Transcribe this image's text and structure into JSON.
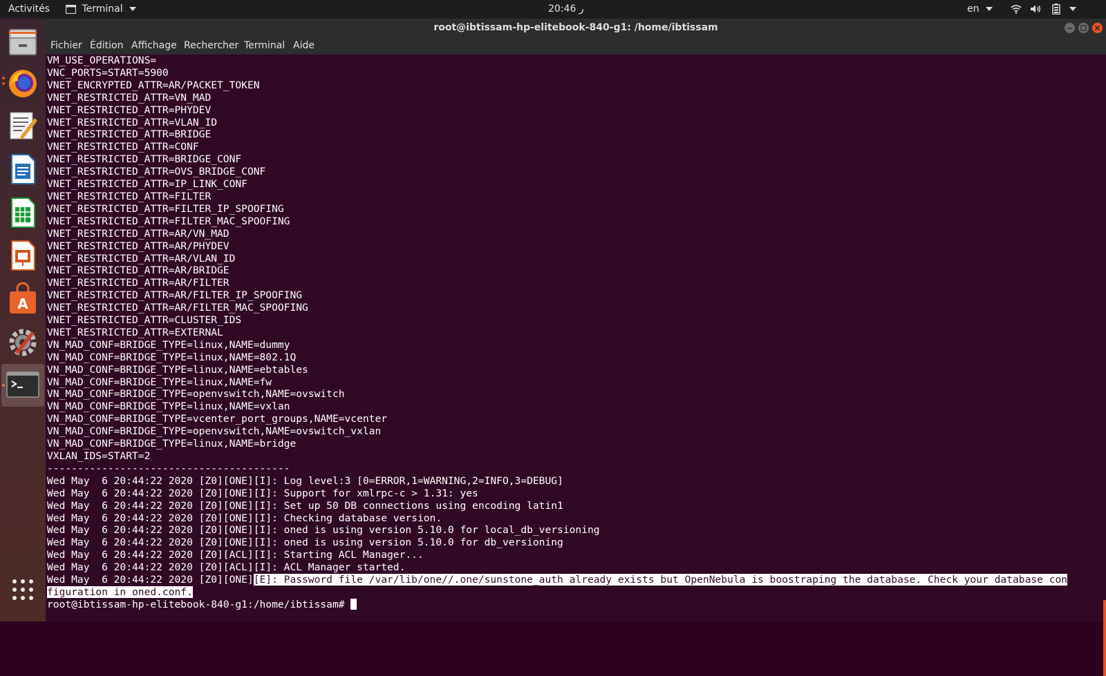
{
  "topbar": {
    "activities": "Activités",
    "app_menu": "Terminal",
    "clock": "20:46 ر",
    "lang": "en",
    "icons": [
      "wifi-icon",
      "volume-icon",
      "battery-icon",
      "system-menu-caret"
    ]
  },
  "window": {
    "title": "root@ibtissam-hp-elitebook-840-g1: /home/ibtissam",
    "menu": [
      "Fichier",
      "Édition",
      "Affichage",
      "Rechercher",
      "Terminal",
      "Aide"
    ]
  },
  "dock": {
    "apps": [
      "files-icon",
      "firefox-icon",
      "text-editor-icon",
      "writer-icon",
      "calc-icon",
      "impress-icon",
      "software-center-icon",
      "settings-icon",
      "terminal-icon",
      "show-apps-icon"
    ]
  },
  "colors": {
    "terminal_bg": "#300a24",
    "accent": "#e95420"
  },
  "terminal": {
    "lines": [
      "VM_USE_OPERATIONS=",
      "VNC_PORTS=START=5900",
      "VNET_ENCRYPTED_ATTR=AR/PACKET_TOKEN",
      "VNET_RESTRICTED_ATTR=VN_MAD",
      "VNET_RESTRICTED_ATTR=PHYDEV",
      "VNET_RESTRICTED_ATTR=VLAN_ID",
      "VNET_RESTRICTED_ATTR=BRIDGE",
      "VNET_RESTRICTED_ATTR=CONF",
      "VNET_RESTRICTED_ATTR=BRIDGE_CONF",
      "VNET_RESTRICTED_ATTR=OVS_BRIDGE_CONF",
      "VNET_RESTRICTED_ATTR=IP_LINK_CONF",
      "VNET_RESTRICTED_ATTR=FILTER",
      "VNET_RESTRICTED_ATTR=FILTER_IP_SPOOFING",
      "VNET_RESTRICTED_ATTR=FILTER_MAC_SPOOFING",
      "VNET_RESTRICTED_ATTR=AR/VN_MAD",
      "VNET_RESTRICTED_ATTR=AR/PHYDEV",
      "VNET_RESTRICTED_ATTR=AR/VLAN_ID",
      "VNET_RESTRICTED_ATTR=AR/BRIDGE",
      "VNET_RESTRICTED_ATTR=AR/FILTER",
      "VNET_RESTRICTED_ATTR=AR/FILTER_IP_SPOOFING",
      "VNET_RESTRICTED_ATTR=AR/FILTER_MAC_SPOOFING",
      "VNET_RESTRICTED_ATTR=CLUSTER_IDS",
      "VNET_RESTRICTED_ATTR=EXTERNAL",
      "VN_MAD_CONF=BRIDGE_TYPE=linux,NAME=dummy",
      "VN_MAD_CONF=BRIDGE_TYPE=linux,NAME=802.1Q",
      "VN_MAD_CONF=BRIDGE_TYPE=linux,NAME=ebtables",
      "VN_MAD_CONF=BRIDGE_TYPE=linux,NAME=fw",
      "VN_MAD_CONF=BRIDGE_TYPE=openvswitch,NAME=ovswitch",
      "VN_MAD_CONF=BRIDGE_TYPE=linux,NAME=vxlan",
      "VN_MAD_CONF=BRIDGE_TYPE=vcenter_port_groups,NAME=vcenter",
      "VN_MAD_CONF=BRIDGE_TYPE=openvswitch,NAME=ovswitch_vxlan",
      "VN_MAD_CONF=BRIDGE_TYPE=linux,NAME=bridge",
      "VXLAN_IDS=START=2",
      "----------------------------------------",
      "Wed May  6 20:44:22 2020 [Z0][ONE][I]: Log level:3 [0=ERROR,1=WARNING,2=INFO,3=DEBUG]",
      "Wed May  6 20:44:22 2020 [Z0][ONE][I]: Support for xmlrpc-c > 1.31: yes",
      "Wed May  6 20:44:22 2020 [Z0][ONE][I]: Set up 50 DB connections using encoding latin1",
      "Wed May  6 20:44:22 2020 [Z0][ONE][I]: Checking database version.",
      "Wed May  6 20:44:22 2020 [Z0][ONE][I]: oned is using version 5.10.0 for local_db_versioning",
      "Wed May  6 20:44:22 2020 [Z0][ONE][I]: oned is using version 5.10.0 for db_versioning",
      "Wed May  6 20:44:22 2020 [Z0][ACL][I]: Starting ACL Manager...",
      "Wed May  6 20:44:22 2020 [Z0][ACL][I]: ACL Manager started."
    ],
    "error_prefix": "Wed May  6 20:44:22 2020 [Z0][ONE]",
    "error_highlight_1": "[E]: Password file /var/lib/one//.one/sunstone_auth already exists but OpenNebula is boostraping the database. Check your database con",
    "error_highlight_2": "figuration in oned.conf.",
    "prompt": "root@ibtissam-hp-elitebook-840-g1:/home/ibtissam# "
  }
}
